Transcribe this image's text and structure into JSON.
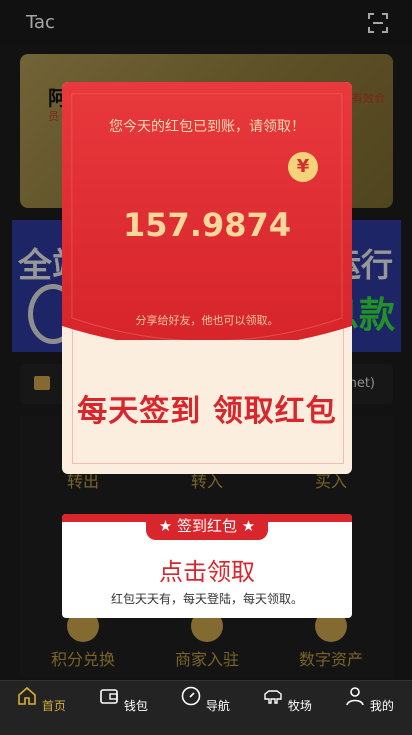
{
  "header": {
    "title": "Tac"
  },
  "gold_card": {
    "name": "阿",
    "sub": "员",
    "right_text": "有效会"
  },
  "banner": {
    "left_text": "全站",
    "right_top": "运行",
    "right_bottom": "息款"
  },
  "notice": {
    "text": "net)"
  },
  "actions": [
    {
      "label": "转出"
    },
    {
      "label": "转入"
    },
    {
      "label": "买入"
    },
    {
      "label": "积分兑换"
    },
    {
      "label": "商家入驻"
    },
    {
      "label": "数字资产"
    }
  ],
  "redpack": {
    "message": "您今天的红包已到账，请领取！",
    "currency_symbol": "¥",
    "amount": "157.9874",
    "share_text": "分享给好友，他也可以领取。",
    "sign_text": "每天签到 领取红包"
  },
  "checkin_card": {
    "tag": "★ 签到红包 ★",
    "button": "点击领取",
    "note": "红包天天有，每天登陆，每天领取。"
  },
  "tabbar": [
    {
      "label": "首页",
      "icon": "home-icon",
      "active": true
    },
    {
      "label": "钱包",
      "icon": "wallet-icon",
      "active": false
    },
    {
      "label": "导航",
      "icon": "compass-icon",
      "active": false
    },
    {
      "label": "牧场",
      "icon": "cow-icon",
      "active": false
    },
    {
      "label": "我的",
      "icon": "user-icon",
      "active": false
    }
  ],
  "colors": {
    "accent_gold": "#d4af37",
    "red": "#d9262c"
  }
}
